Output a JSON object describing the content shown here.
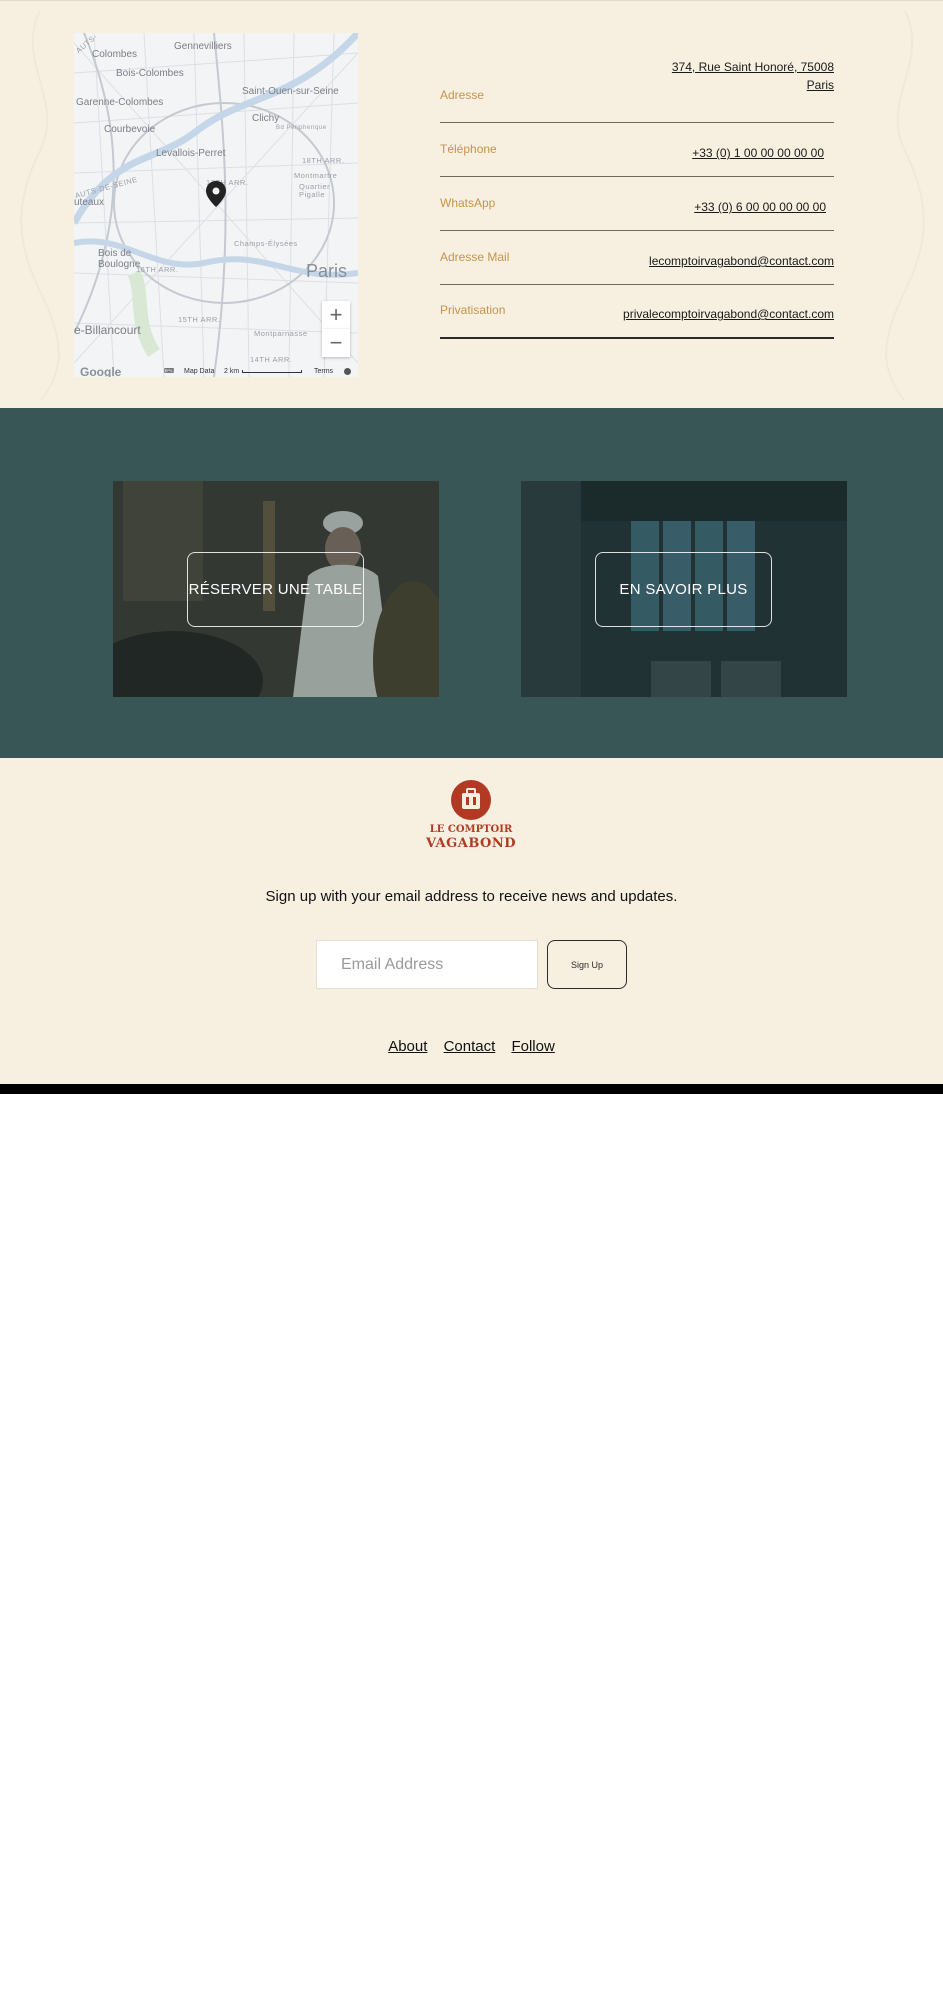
{
  "map": {
    "places": [
      "Gennevilliers",
      "Colombes",
      "Bois-Colombes",
      "Saint-Ouen-sur-Seine",
      "Garenne-Colombes",
      "Courbevoie",
      "Clichy",
      "Levallois-Perret",
      "Paris",
      "Bois de Boulogne",
      "Montmartre",
      "Quartier Pigalle",
      "Champs-Élysées",
      "Montparnasse",
      "e-Billancourt",
      "uteaux",
      "AUTS-DE-SEINE",
      "AUTS-",
      "17TH ARR.",
      "16TH ARR.",
      "15TH ARR.",
      "14TH ARR.",
      "18TH ARR.",
      "Bd Peripherique"
    ],
    "zoom_in": "+",
    "zoom_out": "−",
    "attribution": {
      "keyboard": "⌨",
      "map_data": "Map Data",
      "scale": "2 km",
      "terms": "Terms",
      "google": "Google"
    }
  },
  "contact": {
    "rows": [
      {
        "label": "Adresse",
        "value": "374, Rue Saint Honoré, 75008 Paris"
      },
      {
        "label": "Téléphone",
        "value": "+33 (0) 1 00 00 00 00 00"
      },
      {
        "label": "WhatsApp",
        "value": "+33 (0) 6 00 00 00 00 00"
      },
      {
        "label": "Adresse Mail",
        "value": "lecomptoirvagabond@contact.com"
      },
      {
        "label": "Privatisation",
        "value": "privalecomptoirvagabond@contact.com"
      }
    ]
  },
  "cards": {
    "reserve_label": "RÉSERVER UNE TABLE",
    "more_label": "EN SAVOIR PLUS"
  },
  "footer": {
    "logo_line1": "LE COMPTOIR",
    "logo_line2": "VAGABOND",
    "signup_text": "Sign up with your email address to receive news and updates.",
    "email_placeholder": "Email Address",
    "signup_button": "Sign Up",
    "links": [
      "About",
      "Contact",
      "Follow"
    ]
  },
  "colors": {
    "cream": "#f7f0e1",
    "teal": "#395656",
    "label_gold": "#c5954a",
    "brand_red": "#b23a24"
  }
}
